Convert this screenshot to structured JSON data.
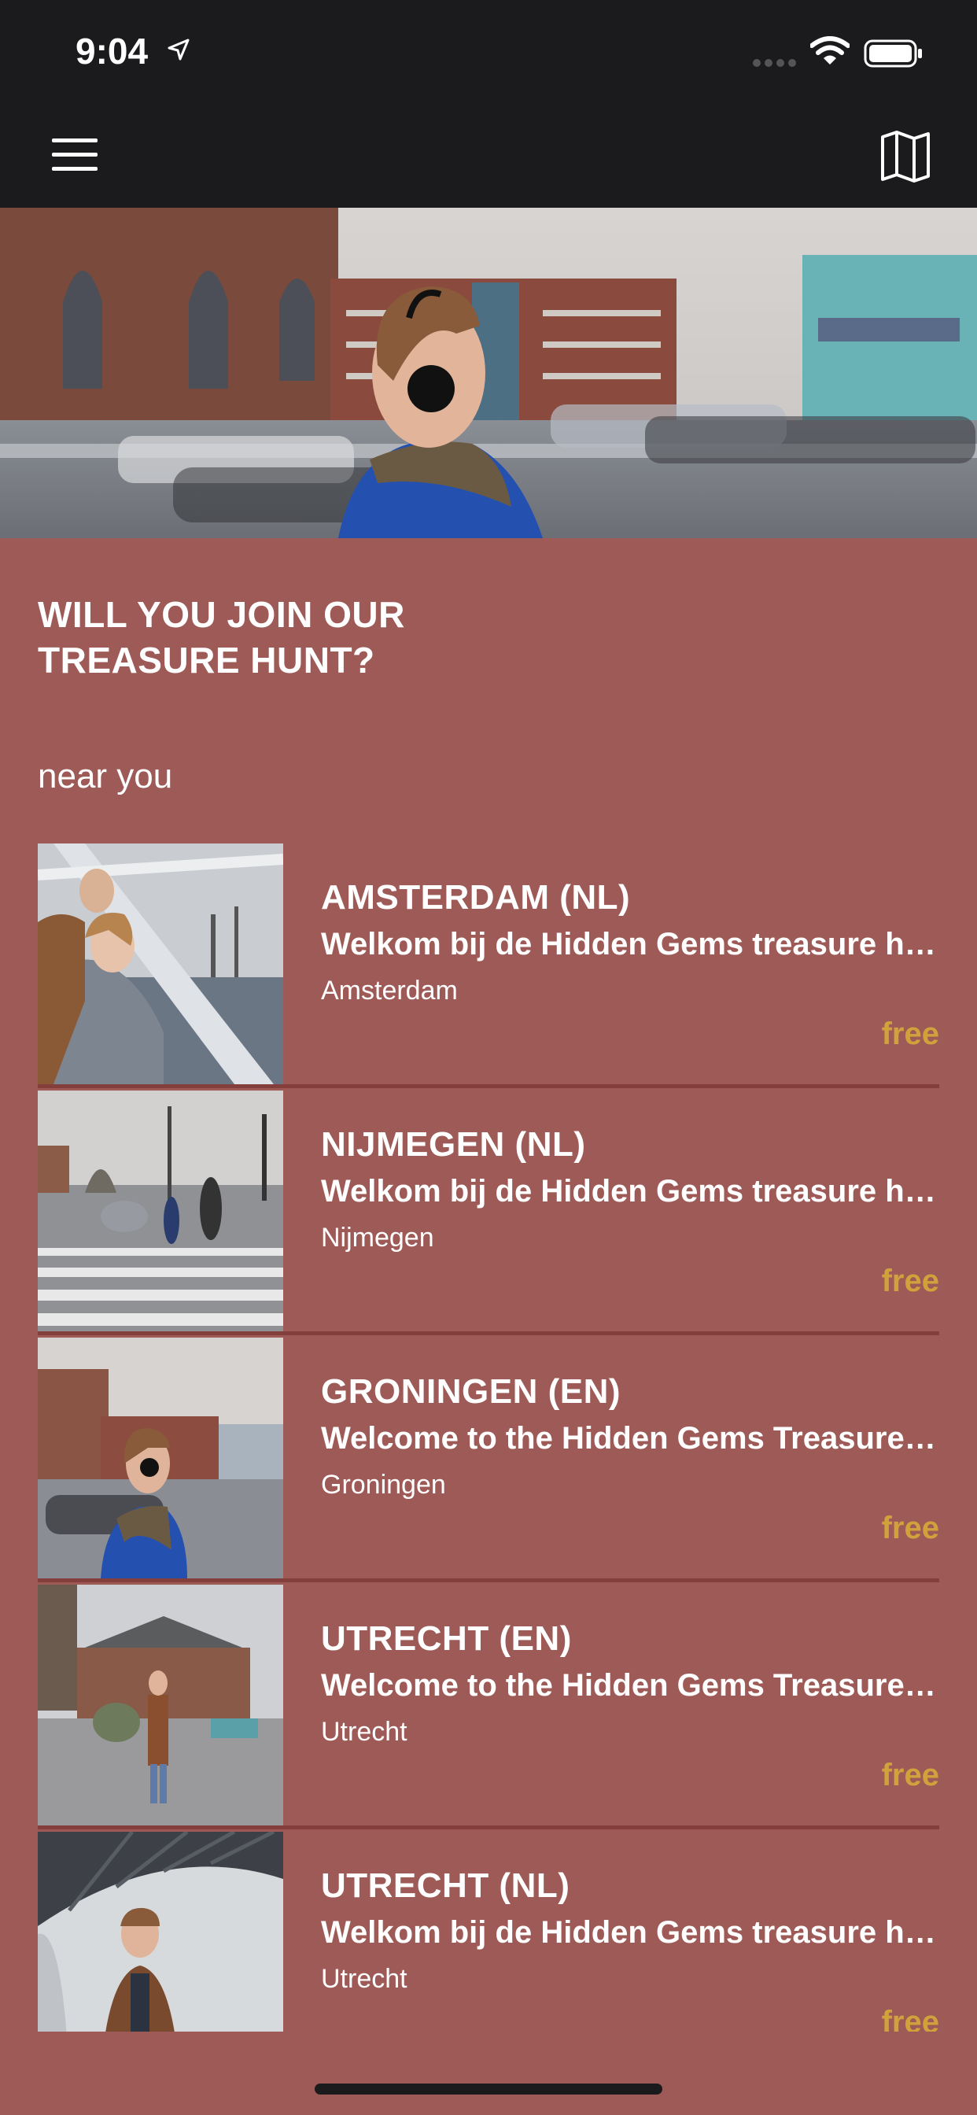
{
  "status_bar": {
    "time": "9:04"
  },
  "header": {
    "menu_icon": "hamburger-icon",
    "map_icon": "map-icon"
  },
  "main": {
    "heading": "WILL YOU JOIN OUR TREASURE HUNT?",
    "section_label": "near you"
  },
  "tours": [
    {
      "title": "AMSTERDAM (NL)",
      "description": "Welkom bij de Hidden Gems treasure hunt in Amsterdam",
      "city": "Amsterdam",
      "price": "free"
    },
    {
      "title": "NIJMEGEN (NL)",
      "description": "Welkom bij de Hidden Gems treasure hunt in Nijmegen",
      "city": "Nijmegen",
      "price": "free"
    },
    {
      "title": "GRONINGEN (EN)",
      "description": "Welcome to the Hidden Gems Treasure Hunt in Groningen",
      "city": "Groningen",
      "price": "free"
    },
    {
      "title": "UTRECHT (EN)",
      "description": "Welcome to the Hidden Gems Treasure Hunt in Utrecht",
      "city": "Utrecht",
      "price": "free"
    },
    {
      "title": "UTRECHT (NL)",
      "description": "Welkom bij de Hidden Gems treasure hunt in Utrecht",
      "city": "Utrecht",
      "price": "free"
    }
  ],
  "colors": {
    "background": "#9e5a56",
    "bar": "#1b1b1d",
    "price": "#d1a23c",
    "divider": "#843f3c"
  }
}
